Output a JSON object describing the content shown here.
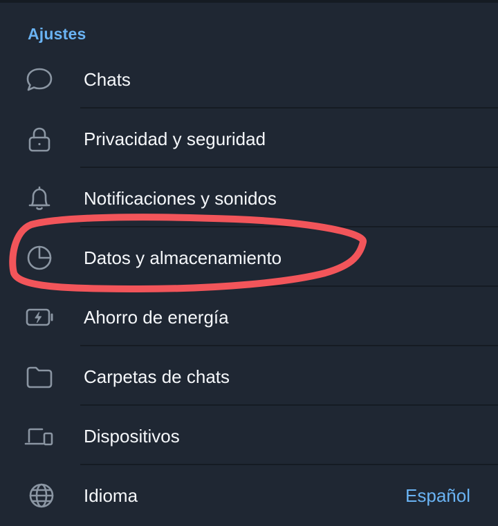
{
  "settings": {
    "section_title": "Ajustes",
    "items": [
      {
        "label": "Chats",
        "icon": "chat-bubble-icon"
      },
      {
        "label": "Privacidad y seguridad",
        "icon": "lock-icon"
      },
      {
        "label": "Notificaciones y sonidos",
        "icon": "bell-icon"
      },
      {
        "label": "Datos y almacenamiento",
        "icon": "pie-chart-icon"
      },
      {
        "label": "Ahorro de energía",
        "icon": "battery-icon"
      },
      {
        "label": "Carpetas de chats",
        "icon": "folder-icon"
      },
      {
        "label": "Dispositivos",
        "icon": "devices-icon"
      },
      {
        "label": "Idioma",
        "icon": "globe-icon",
        "value": "Español"
      }
    ]
  },
  "colors": {
    "background": "#1f2733",
    "accent": "#6ab3f3",
    "text": "#f5f7fa",
    "icon": "#8b96a3",
    "annotation": "#f2555a"
  }
}
